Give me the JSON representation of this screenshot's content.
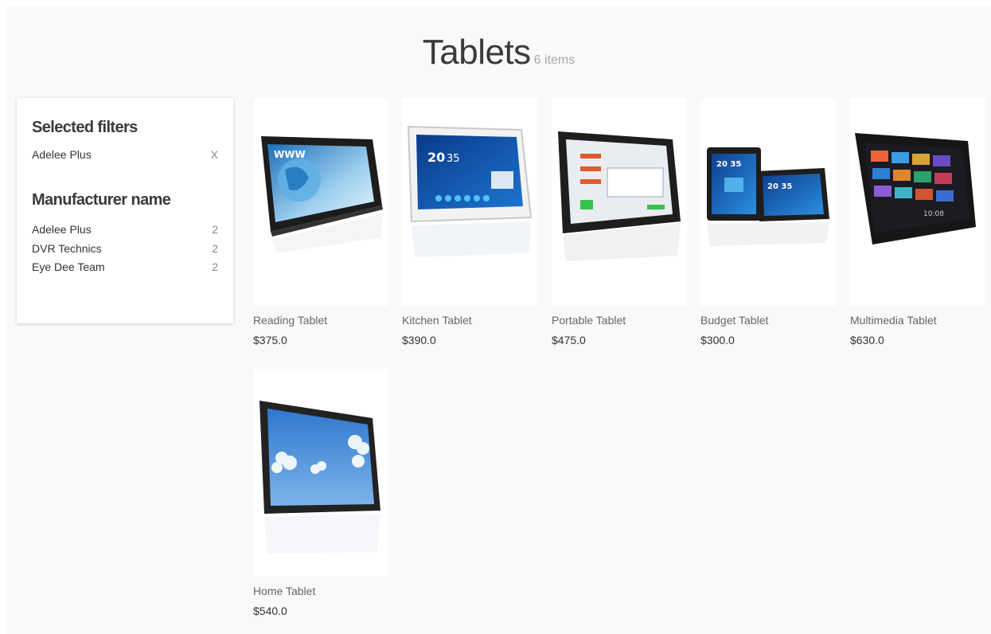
{
  "page": {
    "title": "Tablets",
    "item_count": "6 items"
  },
  "filters": {
    "selected_heading": "Selected filters",
    "selected": [
      {
        "label": "Adelee Plus",
        "remove": "X"
      }
    ],
    "manufacturer_heading": "Manufacturer name",
    "manufacturers": [
      {
        "label": "Adelee Plus",
        "count": "2"
      },
      {
        "label": "DVR Technics",
        "count": "2"
      },
      {
        "label": "Eye Dee Team",
        "count": "2"
      }
    ]
  },
  "products": [
    {
      "name": "Reading Tablet",
      "price": "$375.0",
      "icon": "tablet-www-image"
    },
    {
      "name": "Kitchen Tablet",
      "price": "$390.0",
      "icon": "white-tablet-image"
    },
    {
      "name": "Portable Tablet",
      "price": "$475.0",
      "icon": "dashboard-tablet-image"
    },
    {
      "name": "Budget Tablet",
      "price": "$300.0",
      "icon": "two-tablets-image"
    },
    {
      "name": "Multimedia Tablet",
      "price": "$630.0",
      "icon": "media-tablet-image"
    },
    {
      "name": "Home Tablet",
      "price": "$540.0",
      "icon": "sky-tablet-image"
    }
  ]
}
